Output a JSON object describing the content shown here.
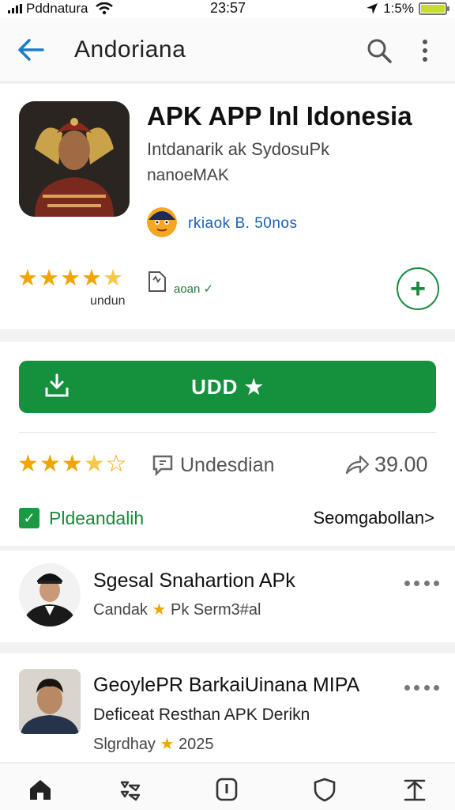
{
  "status_bar": {
    "carrier": "Pddnatura",
    "time": "23:57",
    "battery": "1:5%"
  },
  "app_bar": {
    "title": "Andoriana"
  },
  "app": {
    "title": "APK APP Inl Idonesia",
    "subtitle_line1": "Intdanarik ak SydosuPk",
    "subtitle_line2": "nanoeMAK",
    "developer": "rkiaok B. 50nos",
    "under_label": "undun",
    "size_text": "aoan ✓",
    "plus_symbol": "+"
  },
  "install": {
    "button_label": "UDD ★",
    "review_text": "Undesdian",
    "share_count": "39.00",
    "checkbox_label": "Pldeandalih",
    "more_link": "Seomgabollan>"
  },
  "list": [
    {
      "title": "Sgesal Snahartion APk",
      "sub": "",
      "meta_left": "Candak",
      "meta_right": "Pk Serm3#al"
    },
    {
      "title": "GeoylePR BarkaiUinana MIPA",
      "sub": "Deficeat Resthan APK Derikn",
      "meta_left": "Slgrdhay",
      "meta_right": "2025"
    }
  ],
  "icons": {
    "back": "arrow-left-icon",
    "search": "search-icon",
    "more": "more-vert-icon",
    "download": "download-icon",
    "review": "review-icon",
    "share": "share-icon",
    "nav": [
      "home-icon",
      "apps-icon",
      "info-icon",
      "shield-icon",
      "upload-icon"
    ]
  },
  "colors": {
    "accent_green": "#15913d",
    "link_blue": "#1a5fb4",
    "star_orange": "#f0a500",
    "back_blue": "#1b7ec9"
  }
}
